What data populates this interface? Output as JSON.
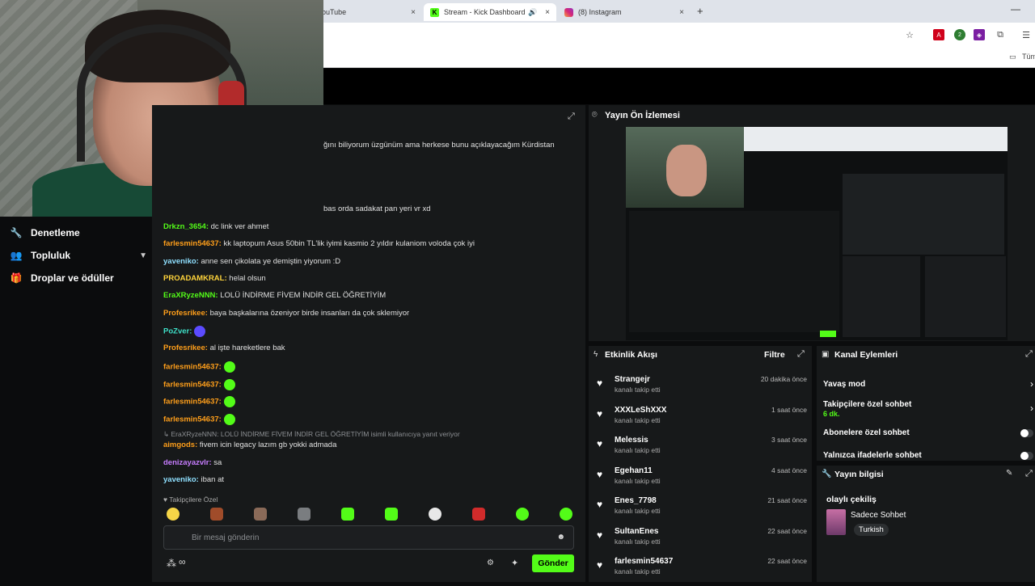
{
  "browser": {
    "tabs": [
      {
        "label": "ouTube",
        "close": "×"
      },
      {
        "label": "Stream - Kick Dashboard",
        "close": "×"
      },
      {
        "label": "(8) Instagram",
        "close": "×"
      }
    ],
    "new_tab": "+",
    "bookmark_label": "Tüm"
  },
  "sidebar": {
    "items": [
      {
        "label": "Denetleme"
      },
      {
        "label": "Topluluk"
      },
      {
        "label": "Droplar ve ödüller"
      }
    ]
  },
  "chat": {
    "partial_lines": [
      "ğını biliyorum üzgünüm ama herkese bunu açıklayacağım Kürdistan",
      "bas orda sadakat pan yeri vr xd"
    ],
    "messages": [
      {
        "user": "Drkzn_3654",
        "color": "#53fc18",
        "text": " dc link ver ahmet"
      },
      {
        "user": "farlesmin54637",
        "color": "#ff9f1a",
        "text": " kk laptopum Asus 50bin TL'lik iyimi kasmio 2 yıldır kulaniom voloda çok iyi"
      },
      {
        "user": "yaveniko",
        "color": "#8fe0ff",
        "text": " anne sen çikolata ye demiştin yiyorum :D"
      },
      {
        "user": "PROADAMKRAL",
        "color": "#ffd43b",
        "text": " helal olsun"
      },
      {
        "user": "EraXRyzeNNN",
        "color": "#53fc18",
        "text": " LOLÜ İNDİRME FİVEM İNDİR GEL ÖĞRETİYİM"
      },
      {
        "user": "Profesrikee",
        "color": "#ff9f1a",
        "text": " baya başkalarına özeniyor birde insanları da çok sklemiyor"
      },
      {
        "user": "PoZver",
        "color": "#3ee0c8",
        "text": ""
      },
      {
        "user": "Profesrikee",
        "color": "#ff9f1a",
        "text": " al işte hareketlere bak"
      },
      {
        "user": "farlesmin54637",
        "color": "#ff9f1a",
        "text": ""
      },
      {
        "user": "farlesmin54637",
        "color": "#ff9f1a",
        "text": ""
      },
      {
        "user": "farlesmin54637",
        "color": "#ff9f1a",
        "text": ""
      },
      {
        "user": "farlesmin54637",
        "color": "#ff9f1a",
        "text": ""
      },
      {
        "user": "aimgods",
        "color": "#ff9f1a",
        "text": " fivem icin legacy lazım gb yokki admada"
      },
      {
        "user": "denizayazvlr",
        "color": "#c77dff",
        "text": " sa"
      },
      {
        "user": "yaveniko",
        "color": "#8fe0ff",
        "text": " iban at"
      }
    ],
    "reply_note": "↳ EraXRyzeNNN: LOLÜ İNDİRME FİVEM İNDİR GEL ÖĞRETİYİM isimli kullanıcıya yanıt veriyor",
    "followers_only": "♥ Takipçilere Özel",
    "input_placeholder": "Bir mesaj gönderin",
    "send_label": "Gönder",
    "infinity": "∞"
  },
  "preview": {
    "title": "Yayın Ön İzlemesi"
  },
  "activity": {
    "title": "Etkinlik Akışı",
    "filter": "Filtre",
    "items": [
      {
        "name": "Strangejr",
        "sub": "kanalı takip etti",
        "time": "20 dakika önce"
      },
      {
        "name": "XXXLeShXXX",
        "sub": "kanalı takip etti",
        "time": "1 saat önce"
      },
      {
        "name": "Melessis",
        "sub": "kanalı takip etti",
        "time": "3 saat önce"
      },
      {
        "name": "Egehan11",
        "sub": "kanalı takip etti",
        "time": "4 saat önce"
      },
      {
        "name": "Enes_7798",
        "sub": "kanalı takip etti",
        "time": "21 saat önce"
      },
      {
        "name": "SultanEnes",
        "sub": "kanalı takip etti",
        "time": "22 saat önce"
      },
      {
        "name": "farlesmin54637",
        "sub": "kanalı takip etti",
        "time": "22 saat önce"
      }
    ]
  },
  "channel_actions": {
    "title": "Kanal Eylemleri",
    "slow_mode": "Yavaş mod",
    "followers_chat": "Takipçilere özel sohbet",
    "followers_duration": "6 dk.",
    "subs_chat": "Abonelere özel sohbet",
    "emote_chat": "Yalnızca ifadelerle sohbet"
  },
  "stream_info": {
    "title": "Yayın bilgisi",
    "stream_title": "olaylı çekiliş",
    "category": "Sadece Sohbet",
    "language": "Turkish"
  },
  "colors": {
    "accent": "#53fc18",
    "panel": "#17191a",
    "background": "#0b0c0d"
  }
}
